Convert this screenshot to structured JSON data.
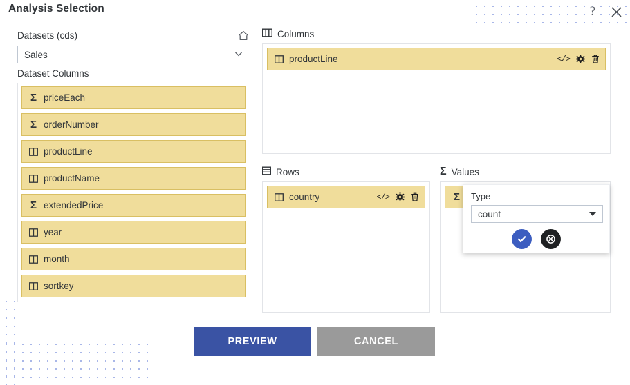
{
  "header": {
    "title": "Analysis Selection",
    "help_icon": "question-mark-icon",
    "help_label": "?",
    "close_icon": "close-icon",
    "close_label": "✕"
  },
  "left_pane": {
    "datasets_label": "Datasets (cds)",
    "home_icon": "home-icon",
    "dataset_select": {
      "value": "Sales",
      "options": [
        "Sales"
      ]
    },
    "dataset_columns_label": "Dataset Columns",
    "columns": [
      {
        "name": "priceEach",
        "type": "measure",
        "icon": "sigma-icon"
      },
      {
        "name": "orderNumber",
        "type": "measure",
        "icon": "sigma-icon"
      },
      {
        "name": "productLine",
        "type": "dimension",
        "icon": "column-icon"
      },
      {
        "name": "productName",
        "type": "dimension",
        "icon": "column-icon"
      },
      {
        "name": "extendedPrice",
        "type": "measure",
        "icon": "sigma-icon"
      },
      {
        "name": "year",
        "type": "dimension",
        "icon": "column-icon"
      },
      {
        "name": "month",
        "type": "dimension",
        "icon": "column-icon"
      },
      {
        "name": "sortkey",
        "type": "dimension",
        "icon": "column-icon"
      }
    ]
  },
  "columns_panel": {
    "title": "Columns",
    "icon": "columns-table-icon",
    "items": [
      {
        "name": "productLine",
        "icon": "column-icon",
        "actions": {
          "code": "</>",
          "settings": "gear-icon",
          "delete": "trash-icon"
        }
      }
    ]
  },
  "rows_panel": {
    "title": "Rows",
    "icon": "rows-table-icon",
    "items": [
      {
        "name": "country",
        "icon": "column-icon",
        "actions": {
          "code": "</>",
          "settings": "gear-icon",
          "delete": "trash-icon"
        }
      }
    ]
  },
  "values_panel": {
    "title": "Values",
    "icon": "sigma-icon",
    "items": [
      {
        "name": "",
        "icon": "sigma-icon"
      }
    ]
  },
  "type_popup": {
    "label": "Type",
    "select": {
      "value": "count",
      "options": [
        "count"
      ]
    },
    "confirm_icon": "check-icon",
    "cancel_icon": "circle-x-icon"
  },
  "footer": {
    "preview_label": "PREVIEW",
    "cancel_label": "CANCEL"
  },
  "colors": {
    "chip_background": "#f0dd9b",
    "chip_border": "#d9bf63",
    "preview_button": "#3a53a4",
    "cancel_button": "#9a9a9a",
    "confirm_button": "#3c5dc0",
    "popup_cancel_button": "#1f2123",
    "dot_pattern": "#a9b7e8"
  }
}
